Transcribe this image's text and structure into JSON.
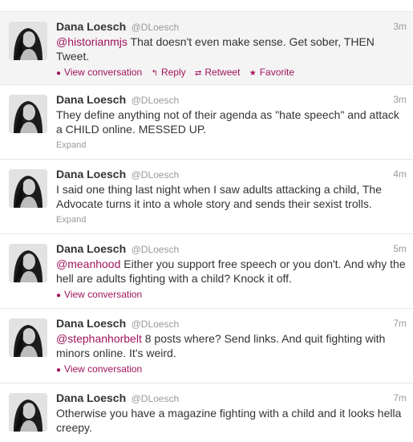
{
  "tweets": [
    {
      "name": "Dana Loesch",
      "handle": "@DLoesch",
      "time": "3m",
      "mention": "@historianmjs",
      "text": " That doesn't even make sense. Get sober, THEN Tweet.",
      "actions": {
        "view_conversation": "View conversation",
        "reply": "Reply",
        "retweet": "Retweet",
        "favorite": "Favorite"
      }
    },
    {
      "name": "Dana Loesch",
      "handle": "@DLoesch",
      "time": "3m",
      "text": "They define anything not of their agenda as \"hate speech\" and attack a CHILD online. MESSED UP.",
      "expand": "Expand"
    },
    {
      "name": "Dana Loesch",
      "handle": "@DLoesch",
      "time": "4m",
      "text": "I said one thing last night when I saw adults attacking a child, The Advocate turns it into a whole story and sends their sexist trolls.",
      "expand": "Expand"
    },
    {
      "name": "Dana Loesch",
      "handle": "@DLoesch",
      "time": "5m",
      "mention": "@meanhood",
      "text": " Either you support free speech or you don't. And why the hell are adults fighting with a child? Knock it off.",
      "view_conversation": "View conversation"
    },
    {
      "name": "Dana Loesch",
      "handle": "@DLoesch",
      "time": "7m",
      "mention": "@stephanhorbelt",
      "text": " 8 posts where? Send links. And quit fighting with minors online. It's weird.",
      "view_conversation": "View conversation"
    },
    {
      "name": "Dana Loesch",
      "handle": "@DLoesch",
      "time": "7m",
      "text": "Otherwise you have a magazine fighting with a child and it looks hella creepy."
    }
  ],
  "icons": {
    "conversation": "speech-bubble-icon",
    "reply": "reply-arrow-icon",
    "retweet": "retweet-icon",
    "favorite": "star-icon"
  },
  "colors": {
    "link": "#a0155f",
    "meta": "#999999",
    "highlight_bg": "#f4f4f4"
  }
}
